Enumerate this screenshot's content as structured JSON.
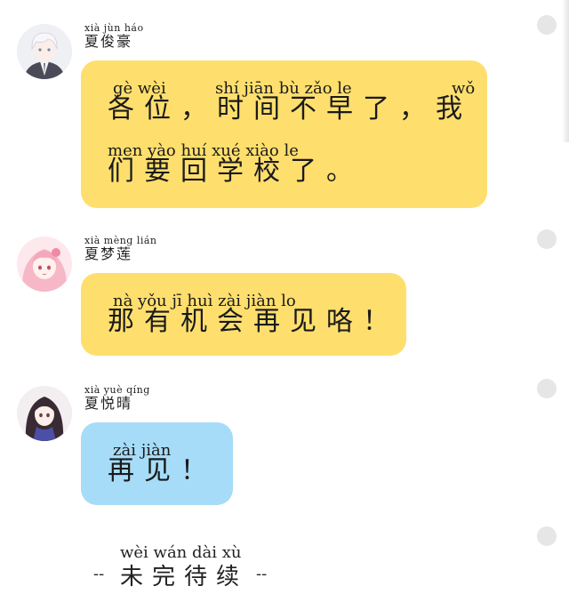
{
  "messages": [
    {
      "sender_pinyin": "xià jùn háo",
      "sender_name": "夏俊豪",
      "line1_pinyin": [
        "gè wèi",
        "shí jiān bù zǎo le",
        "wǒ"
      ],
      "line1_text": "各位，时间不早了，我",
      "line2_pinyin": [
        "men yào huí xué xiào le"
      ],
      "line2_text": "们要回学校了。",
      "bubble_color": "#fedf6e"
    },
    {
      "sender_pinyin": "xià mèng lián",
      "sender_name": "夏梦莲",
      "line1_pinyin": [
        "nà yǒu jī huì zài jiàn lo"
      ],
      "line1_text": "那有机会再见咯！",
      "bubble_color": "#fedf6e"
    },
    {
      "sender_pinyin": "xià yuè qíng",
      "sender_name": "夏悦晴",
      "line1_pinyin": [
        "zài jiàn"
      ],
      "line1_text": "再见！",
      "bubble_color": "#a6dcf8"
    }
  ],
  "footer": {
    "pinyin": "wèi wán dài xù",
    "dash_left": "--",
    "text": "未完待续",
    "dash_right": "--"
  }
}
